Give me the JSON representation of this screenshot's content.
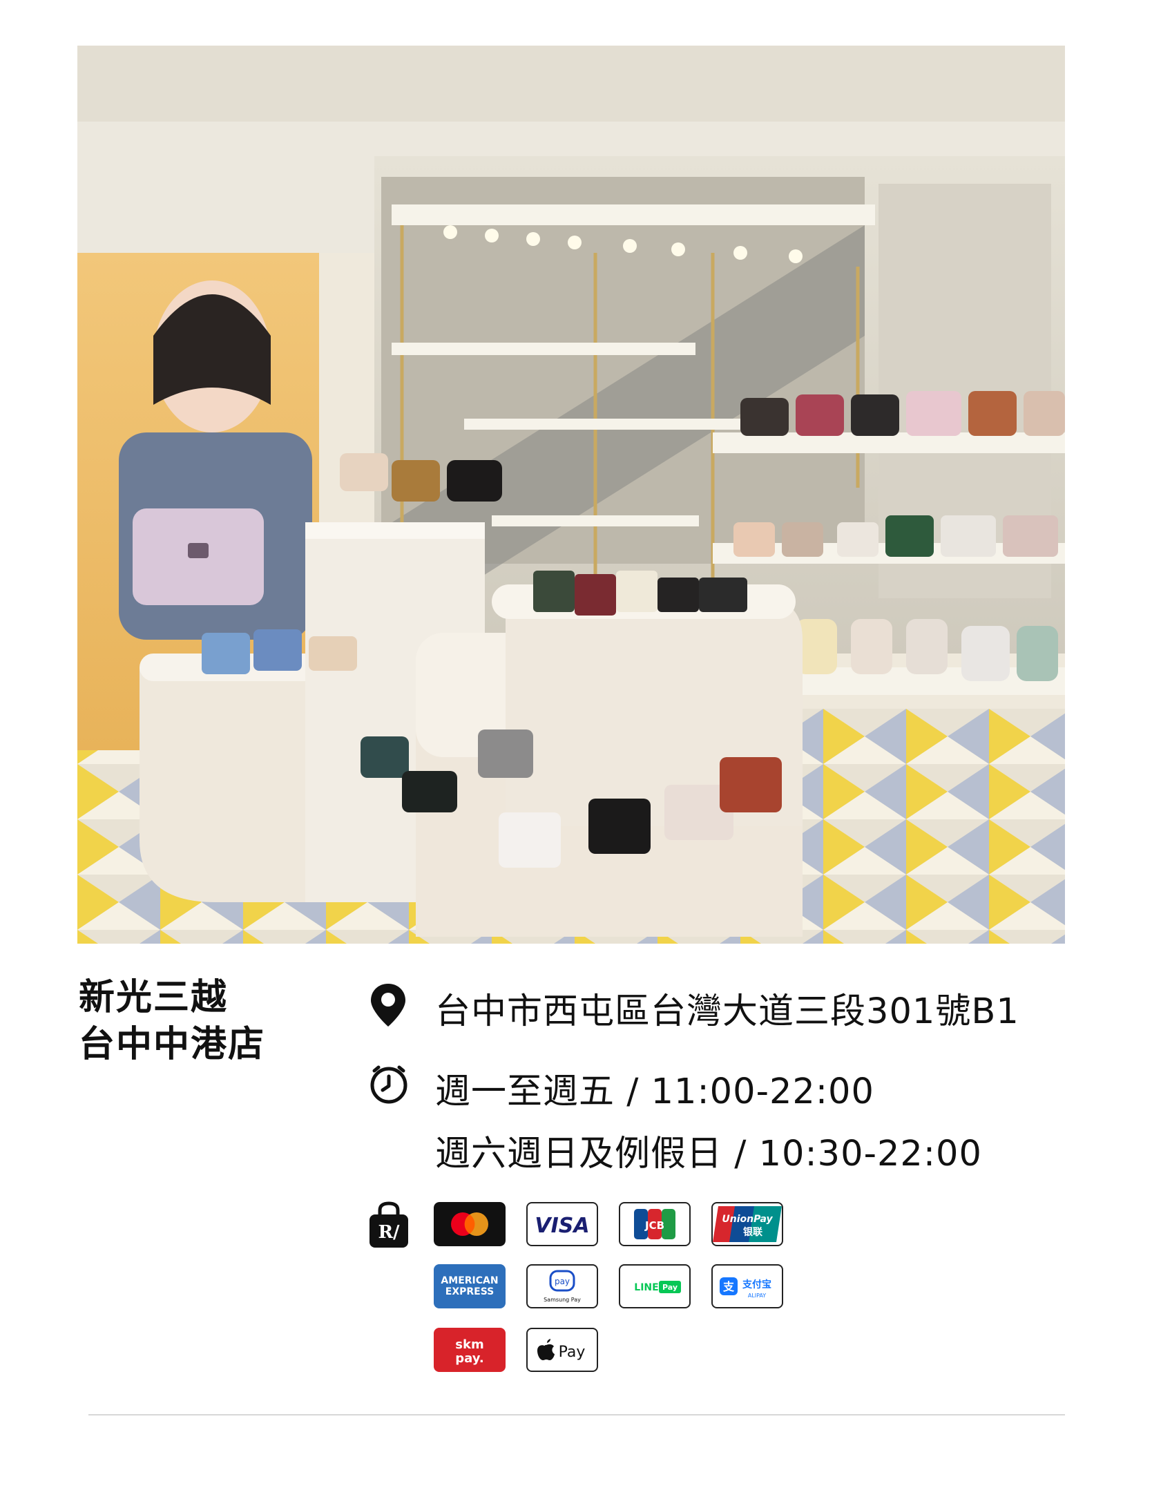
{
  "store": {
    "name_line1": "新光三越",
    "name_line2": "台中中港店",
    "address": "台中市西屯區台灣大道三段301號B1",
    "hours_weekday": "週一至週五 / 11:00-22:00",
    "hours_weekend": "週六週日及例假日  / 10:30-22:00"
  },
  "icons": {
    "location": "location-pin-icon",
    "clock": "clock-icon",
    "payment": "shopping-bag-icon"
  },
  "payments": {
    "visa": "VISA",
    "jcb": "JCB",
    "unionpay_line1": "UnionPay",
    "unionpay_line2": "银联",
    "amex_line1": "AMERICAN",
    "amex_line2": "EXPRESS",
    "samsung_top": "pay",
    "samsung_bottom": "Samsung Pay",
    "linepay_left": "LINE",
    "linepay_right": "Pay",
    "alipay_cn": "支付宝",
    "alipay_en": "ALIPAY",
    "skm_line1": "skm",
    "skm_line2": "pay.",
    "applepay": "Pay"
  },
  "colors": {
    "mastercard_red": "#eb001b",
    "mastercard_orange": "#f79e1b",
    "visa_blue": "#1a1f71",
    "unionpay_red": "#d7262d",
    "amex_blue": "#2d6fbb",
    "linepay_green": "#06c755",
    "alipay_blue": "#1677ff",
    "skm_red": "#d8232a"
  }
}
